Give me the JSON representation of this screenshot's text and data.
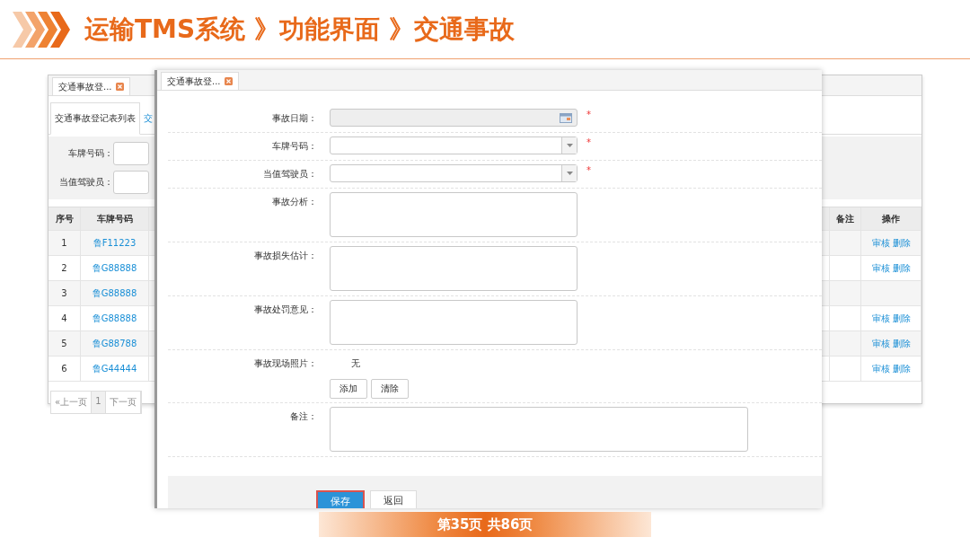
{
  "slide": {
    "title": "运输TMS系统 》功能界面 》交通事故",
    "page_label": "第35页  共86页"
  },
  "list_window": {
    "tab": {
      "label": "交通事故登...",
      "closable": true
    },
    "subtabs": [
      {
        "label": "交通事故登记表列表",
        "selected": true
      },
      {
        "label": "交",
        "selected": false
      }
    ],
    "filters": [
      {
        "label": "车牌号码："
      },
      {
        "label": "当值驾驶员："
      }
    ],
    "columns": [
      "序号",
      "车牌号码",
      "备注",
      "操作"
    ],
    "rows": [
      {
        "index": "1",
        "plate": "鲁F11223",
        "actions": [
          "审核",
          "删除"
        ]
      },
      {
        "index": "2",
        "plate": "鲁G88888",
        "actions": [
          "审核",
          "删除"
        ]
      },
      {
        "index": "3",
        "plate": "鲁G88888"
      },
      {
        "index": "4",
        "plate": "鲁G88888",
        "actions": [
          "审核",
          "删除"
        ]
      },
      {
        "index": "5",
        "plate": "鲁G88788",
        "actions": [
          "审核",
          "删除"
        ]
      },
      {
        "index": "6",
        "plate": "鲁G44444",
        "actions": [
          "审核",
          "删除"
        ]
      }
    ],
    "pager": [
      {
        "label": "«上一页"
      },
      {
        "label": "1"
      },
      {
        "label": "下一页"
      }
    ]
  },
  "form_window": {
    "tab": {
      "label": "交通事故登...",
      "closable": true
    },
    "fields": [
      {
        "kind": "date",
        "label": "事故日期：",
        "required_mark": "*"
      },
      {
        "kind": "select",
        "label": "车牌号码：",
        "required_mark": "*"
      },
      {
        "kind": "select",
        "label": "当值驾驶员：",
        "required_mark": "*"
      },
      {
        "kind": "textarea",
        "label": "事故分析："
      },
      {
        "kind": "textarea",
        "label": "事故损失估计："
      },
      {
        "kind": "textarea",
        "label": "事故处罚意见："
      },
      {
        "kind": "photo",
        "label": "事故现场照片：",
        "value": "无",
        "buttons": [
          "添加",
          "清除"
        ]
      },
      {
        "kind": "wide_textarea",
        "label": "备注："
      }
    ],
    "actions": [
      {
        "label": "保存",
        "kind": "primary",
        "highlighted": true
      },
      {
        "label": "返回",
        "kind": "default",
        "highlighted": false
      }
    ]
  }
}
